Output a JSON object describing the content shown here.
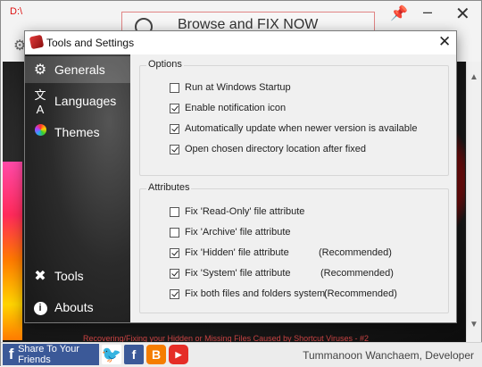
{
  "background_window": {
    "path_label": "D:\\",
    "browse_button_label": "Browse and FIX NOW",
    "recovering_text": "Recovering/Fixing your Hidden or Missing Files Caused by Shortcut Viruses - #2",
    "share_label": "Share To Your Friends",
    "developer_label": "Tummanoon Wanchaem, Developer",
    "icons": [
      "pin-icon",
      "minimize-icon",
      "close-icon",
      "gear-icon",
      "facebook-icon",
      "twitter-icon",
      "blogger-icon",
      "youtube-icon"
    ]
  },
  "dialog": {
    "title": "Tools and Settings",
    "nav": [
      {
        "label": "Generals",
        "icon": "gear-icon",
        "active": true
      },
      {
        "label": "Languages",
        "icon": "language-icon",
        "active": false
      },
      {
        "label": "Themes",
        "icon": "color-wheel-icon",
        "active": false
      },
      {
        "label": "Tools",
        "icon": "tools-icon",
        "active": false
      },
      {
        "label": "Abouts",
        "icon": "info-icon",
        "active": false
      }
    ],
    "options": {
      "title": "Options",
      "items": [
        {
          "label": "Run at Windows Startup",
          "checked": false
        },
        {
          "label": "Enable notification icon",
          "checked": true
        },
        {
          "label": "Automatically update when newer version is available",
          "checked": true
        },
        {
          "label": "Open chosen directory location after fixed",
          "checked": true
        }
      ]
    },
    "attributes": {
      "title": "Attributes",
      "items": [
        {
          "label": "Fix 'Read-Only' file attribute",
          "checked": false,
          "note": ""
        },
        {
          "label": "Fix 'Archive' file attribute",
          "checked": false,
          "note": ""
        },
        {
          "label": "Fix 'Hidden' file attribute",
          "checked": true,
          "note": "(Recommended)"
        },
        {
          "label": "Fix 'System' file attribute",
          "checked": true,
          "note": "(Recommended)"
        },
        {
          "label": "Fix both files and folders system",
          "checked": true,
          "note": "(Recommended)"
        }
      ]
    }
  }
}
